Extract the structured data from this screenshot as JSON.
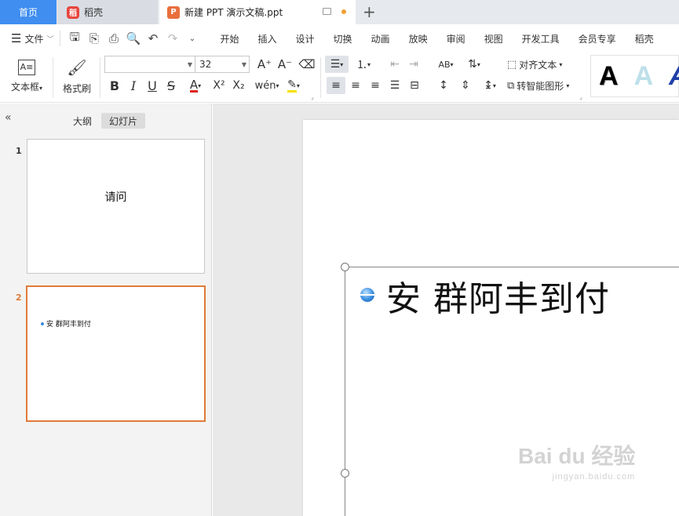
{
  "tabs": {
    "home": "首页",
    "docer": "稻壳",
    "document": "新建 PPT 演示文稿.ppt",
    "add": "+"
  },
  "menu": {
    "file_label": "文件",
    "tabs": [
      "开始",
      "插入",
      "设计",
      "切换",
      "动画",
      "放映",
      "审阅",
      "视图",
      "开发工具",
      "会员专享",
      "稻壳"
    ]
  },
  "ribbon": {
    "textbox_label": "文本框",
    "format_painter_label": "格式刷",
    "font_name": "",
    "font_size": "32",
    "align_text_label": "对齐文本",
    "smartart_label": "转智能图形",
    "wordart_samples": [
      "A",
      "A",
      "A"
    ]
  },
  "sidebar": {
    "tabs": [
      "大纲",
      "幻灯片"
    ],
    "active_tab": "幻灯片",
    "slides": [
      {
        "number": "1",
        "text": "请问"
      },
      {
        "number": "2",
        "text": "安 群阿丰到付"
      }
    ]
  },
  "slide": {
    "bullet_text": "安 群阿丰到付"
  },
  "watermark": {
    "brand": "Bai du 经验",
    "url": "jingyan.baidu.com"
  },
  "colors": {
    "home_tab": "#3f8ef0",
    "selected_slide_border": "#e07b39",
    "font_color_underline": "#e02020",
    "highlight_color": "#f5e000",
    "unsaved_dot": "#f0a030"
  }
}
